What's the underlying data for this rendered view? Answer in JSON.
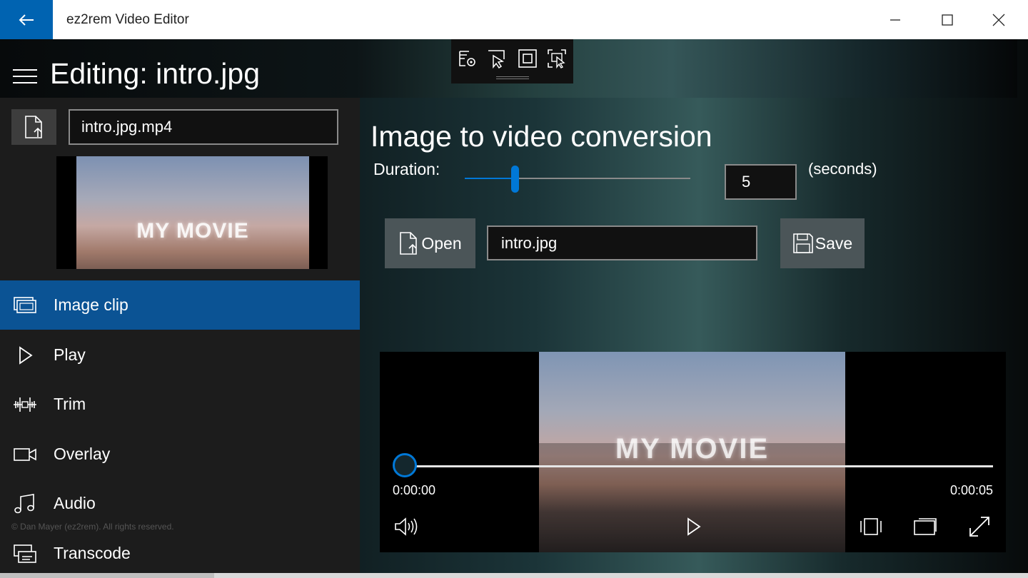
{
  "window": {
    "title": "ez2rem Video Editor",
    "controls": [
      "minimize-icon",
      "maximize-icon",
      "close-icon"
    ]
  },
  "header": {
    "title": "Editing: intro.jpg"
  },
  "floating_toolbar": {
    "icons": [
      "settings-document-icon",
      "pointer-select-icon",
      "fit-frame-icon",
      "fullscreen-select-icon"
    ]
  },
  "sidebar": {
    "output_filename": "intro.jpg.mp4",
    "thumbnail_text": "MY MOVIE",
    "nav": [
      {
        "label": "Image clip",
        "icon": "image-clip-icon",
        "active": true
      },
      {
        "label": "Play",
        "icon": "play-icon",
        "active": false
      },
      {
        "label": "Trim",
        "icon": "trim-icon",
        "active": false
      },
      {
        "label": "Overlay",
        "icon": "video-camera-icon",
        "active": false
      },
      {
        "label": "Audio",
        "icon": "music-note-icon",
        "active": false
      },
      {
        "label": "Transcode",
        "icon": "transcode-icon",
        "active": false
      }
    ],
    "copyright": "© Dan Mayer (ez2rem). All rights reserved."
  },
  "main": {
    "section_title": "Image to video conversion",
    "duration_label": "Duration:",
    "duration_value": "5",
    "duration_unit": "(seconds)",
    "duration_slider_fraction": 0.22,
    "open_label": "Open",
    "file_value": "intro.jpg",
    "save_label": "Save"
  },
  "player": {
    "overlay_text": "MY MOVIE",
    "current_time": "0:00:00",
    "total_time": "0:00:05",
    "progress_fraction": 0
  },
  "colors": {
    "accent": "#0078d7",
    "active_nav": "#0b5394",
    "back_button": "#0063b1"
  }
}
